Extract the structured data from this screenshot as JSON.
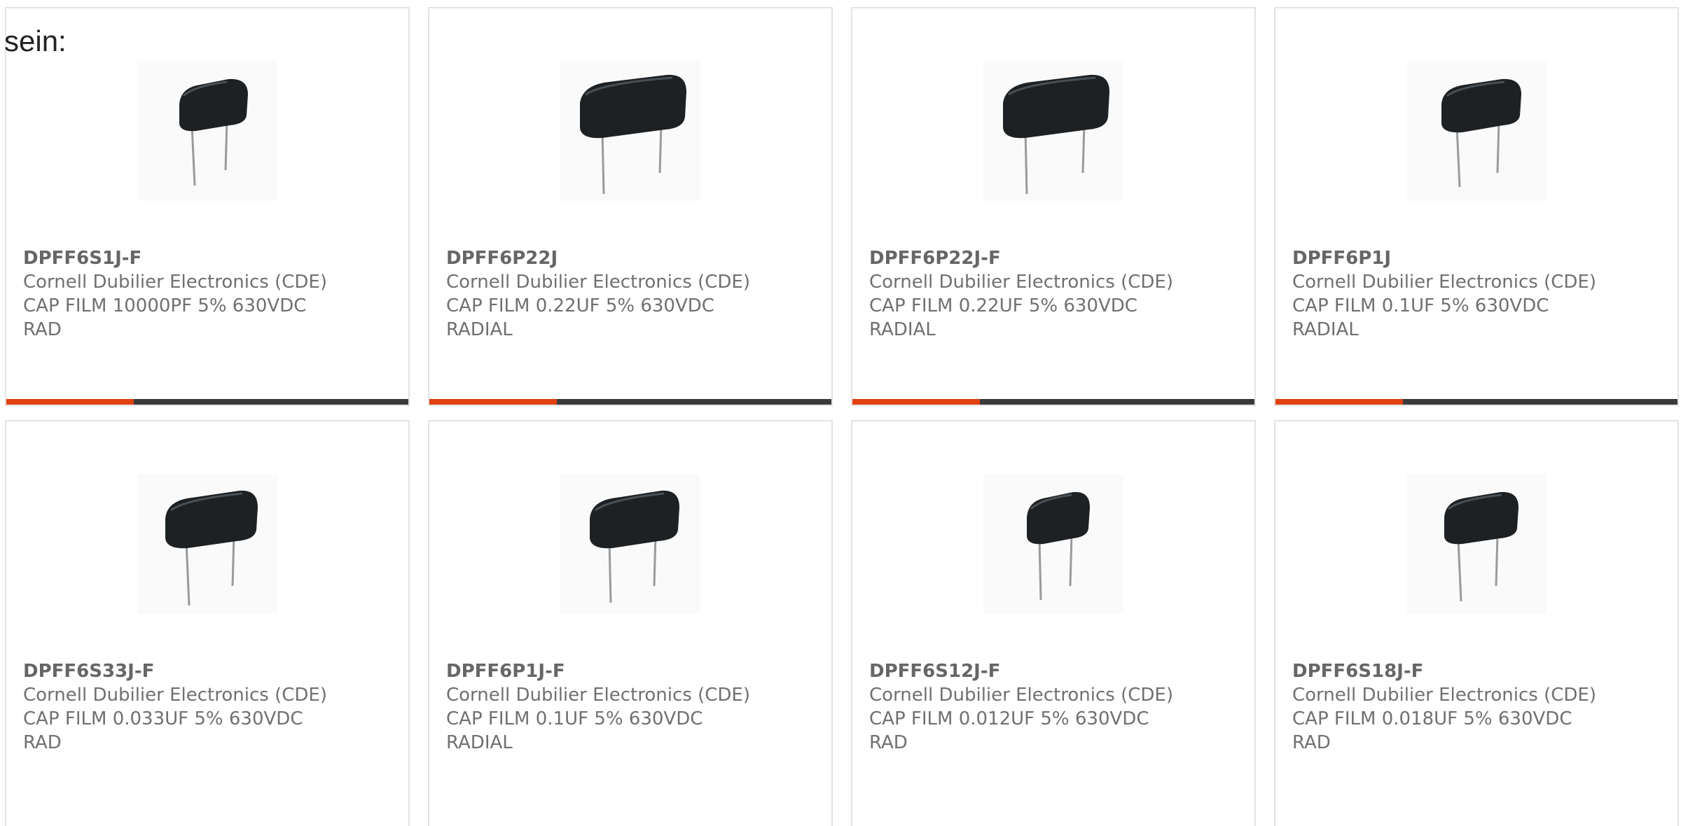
{
  "intro_text": "sein:",
  "colors": {
    "accent": "#e1400f",
    "bar": "#3a3a3a",
    "text": "#707070",
    "border": "#e3e3e3"
  },
  "products": [
    {
      "part": "DPFF6S1J-F",
      "manufacturer": "Cornell Dubilier Electronics (CDE)",
      "desc1": "CAP FILM 10000PF 5% 630VDC",
      "desc2": "RAD",
      "image": "small-film-capacitor"
    },
    {
      "part": "DPFF6P22J",
      "manufacturer": "Cornell Dubilier Electronics (CDE)",
      "desc1": "CAP FILM 0.22UF 5% 630VDC",
      "desc2": "RADIAL",
      "image": "large-film-capacitor"
    },
    {
      "part": "DPFF6P22J-F",
      "manufacturer": "Cornell Dubilier Electronics (CDE)",
      "desc1": "CAP FILM 0.22UF 5% 630VDC",
      "desc2": "RADIAL",
      "image": "large-film-capacitor"
    },
    {
      "part": "DPFF6P1J",
      "manufacturer": "Cornell Dubilier Electronics (CDE)",
      "desc1": "CAP FILM 0.1UF 5% 630VDC",
      "desc2": "RADIAL",
      "image": "small-film-capacitor"
    },
    {
      "part": "DPFF6S33J-F",
      "manufacturer": "Cornell Dubilier Electronics (CDE)",
      "desc1": "CAP FILM 0.033UF 5% 630VDC",
      "desc2": "RAD",
      "image": "medium-film-capacitor"
    },
    {
      "part": "DPFF6P1J-F",
      "manufacturer": "Cornell Dubilier Electronics (CDE)",
      "desc1": "CAP FILM 0.1UF 5% 630VDC",
      "desc2": "RADIAL",
      "image": "medium-film-capacitor"
    },
    {
      "part": "DPFF6S12J-F",
      "manufacturer": "Cornell Dubilier Electronics (CDE)",
      "desc1": "CAP FILM 0.012UF 5% 630VDC",
      "desc2": "RAD",
      "image": "small-film-capacitor"
    },
    {
      "part": "DPFF6S18J-F",
      "manufacturer": "Cornell Dubilier Electronics (CDE)",
      "desc1": "CAP FILM 0.018UF 5% 630VDC",
      "desc2": "RAD",
      "image": "small-film-capacitor"
    }
  ]
}
